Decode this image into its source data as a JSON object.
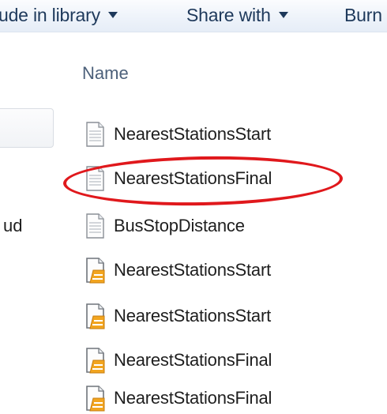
{
  "toolbar": {
    "include_label": "ude in library",
    "share_label": "Share with",
    "burn_label": "Burn"
  },
  "nav": {
    "partial_label": "ud"
  },
  "list": {
    "column_header": "Name",
    "files": [
      {
        "name": "NearestStationsStart",
        "icon": "text-document-icon"
      },
      {
        "name": "NearestStationsFinal",
        "icon": "text-document-icon"
      },
      {
        "name": "BusStopDistance",
        "icon": "text-document-icon"
      },
      {
        "name": "NearestStationsStart",
        "icon": "python-script-icon"
      },
      {
        "name": "NearestStationsStart",
        "icon": "python-script-icon"
      },
      {
        "name": "NearestStationsFinal",
        "icon": "python-script-icon"
      },
      {
        "name": "NearestStationsFinal",
        "icon": "python-script-icon"
      }
    ]
  },
  "annotation": {
    "highlight_color": "#e0181c"
  }
}
